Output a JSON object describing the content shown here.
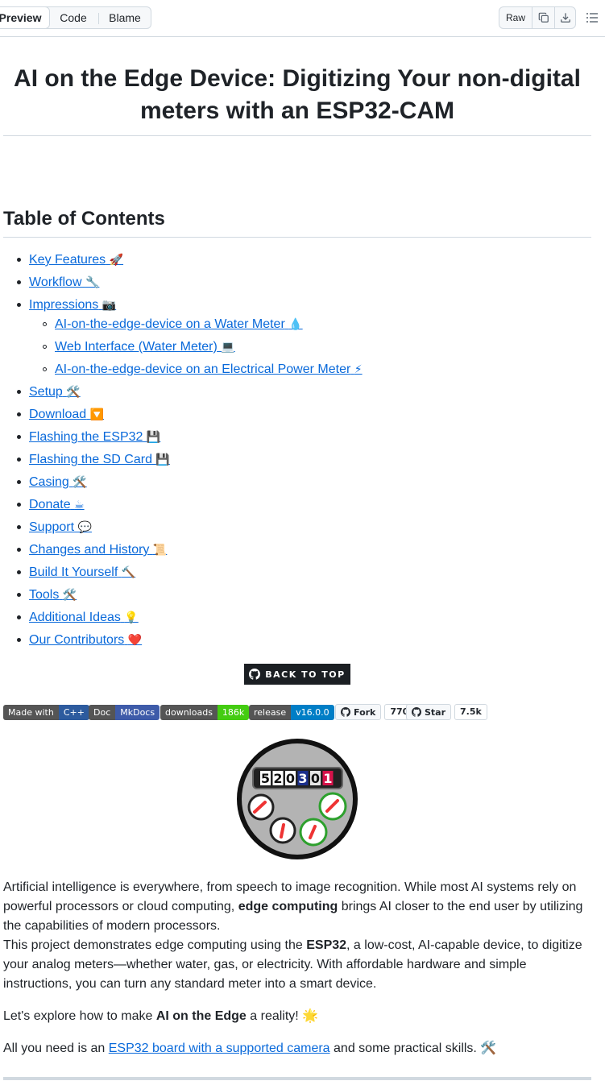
{
  "toolbar": {
    "tabs": [
      {
        "label": "Preview",
        "active": true
      },
      {
        "label": "Code",
        "active": false
      },
      {
        "label": "Blame",
        "active": false
      }
    ],
    "raw_label": "Raw",
    "copy_icon": "copy-icon",
    "download_icon": "download-icon",
    "outline_icon": "list-unordered-icon"
  },
  "title": "AI on the Edge Device: Digitizing Your non-digital meters with an ESP32-CAM",
  "toc": {
    "heading": "Table of Contents",
    "items": [
      {
        "label": "Key Features",
        "emoji": "🚀"
      },
      {
        "label": "Workflow",
        "emoji": "🔧"
      },
      {
        "label": "Impressions",
        "emoji": "📷"
      },
      {
        "label": "AI-on-the-edge-device on a Water Meter",
        "emoji": "💧"
      },
      {
        "label": "Web Interface (Water Meter)",
        "emoji": "💻"
      },
      {
        "label": "AI-on-the-edge-device on an Electrical Power Meter",
        "emoji": "⚡"
      },
      {
        "label": "Setup",
        "emoji": "🛠️"
      },
      {
        "label": "Download",
        "emoji": "🔽"
      },
      {
        "label": "Flashing the ESP32",
        "emoji": "💾"
      },
      {
        "label": "Flashing the SD Card",
        "emoji": "💾"
      },
      {
        "label": "Casing",
        "emoji": "🛠️"
      },
      {
        "label": "Donate",
        "emoji": "☕"
      },
      {
        "label": "Support",
        "emoji": "💬"
      },
      {
        "label": "Changes and History",
        "emoji": "📜"
      },
      {
        "label": "Build It Yourself",
        "emoji": "🔨"
      },
      {
        "label": "Tools",
        "emoji": "🛠️"
      },
      {
        "label": "Additional Ideas",
        "emoji": "💡"
      },
      {
        "label": "Our Contributors",
        "emoji": "❤️"
      }
    ]
  },
  "back_to_top": "BACK TO TOP",
  "badges": [
    {
      "left": "Made with",
      "right": "C++",
      "color": "#2d5b9e"
    },
    {
      "left": "Doc",
      "right": "MkDocs",
      "color": "#3e5ba9"
    },
    {
      "left": "downloads",
      "right": "186k",
      "color": "#4c1"
    },
    {
      "left": "release",
      "right": "v16.0.0",
      "color": "#007ec6"
    }
  ],
  "github_buttons": [
    {
      "label": "Fork",
      "count": "770"
    },
    {
      "label": "Star",
      "count": "7.5k"
    }
  ],
  "logo_digits": [
    "5",
    "2",
    "0",
    "3",
    "0",
    "1"
  ],
  "intro": {
    "p1_a": "Artificial intelligence is everywhere, from speech to image recognition. While most AI systems rely on powerful processors or cloud computing, ",
    "p1_b": "edge computing",
    "p1_c": " brings AI closer to the end user by utilizing the capabilities of modern processors.",
    "p2_a": "This project demonstrates edge computing using the ",
    "p2_b": "ESP32",
    "p2_c": ", a low-cost, AI-capable device, to digitize your analog meters—whether water, gas, or electricity. With affordable hardware and simple instructions, you can turn any standard meter into a smart device.",
    "p3_a": "Let's explore how to make ",
    "p3_b": "AI on the Edge",
    "p3_c": " a reality! 🌟",
    "p4_a": "All you need is an ",
    "p4_link": "ESP32 board with a supported camera",
    "p4_c": " and some practical skills. 🛠️"
  }
}
